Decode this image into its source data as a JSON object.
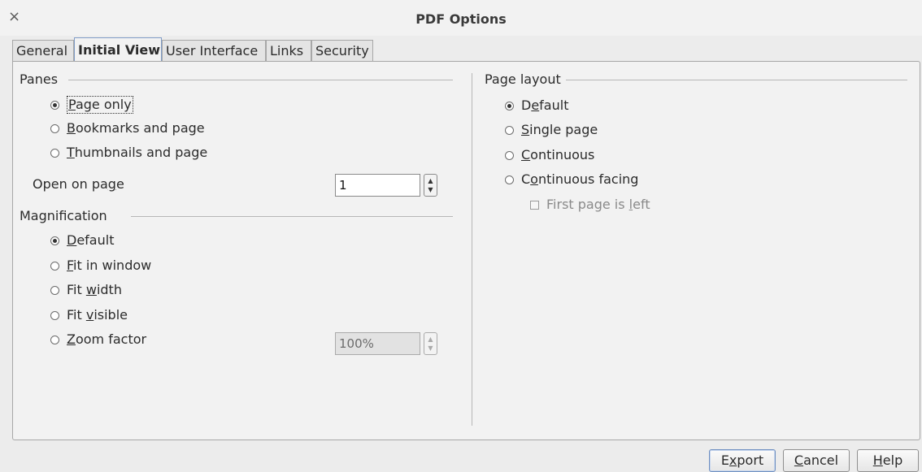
{
  "window": {
    "title": "PDF Options",
    "close_glyph": "×"
  },
  "tabs": [
    {
      "label": "General",
      "active": false
    },
    {
      "label": "Initial View",
      "active": true
    },
    {
      "label": "User Interface",
      "active": false
    },
    {
      "label": "Links",
      "active": false
    },
    {
      "label": "Security",
      "active": false
    }
  ],
  "panes": {
    "heading": "Panes",
    "options": [
      {
        "pre": "",
        "mn": "P",
        "post": "age only",
        "selected": true
      },
      {
        "pre": "",
        "mn": "B",
        "post": "ookmarks and page",
        "selected": false
      },
      {
        "pre": "",
        "mn": "T",
        "post": "humbnails and page",
        "selected": false
      }
    ],
    "open_on_page": {
      "pre": "Open on pa",
      "mn": "g",
      "post": "e",
      "value": "1"
    }
  },
  "magnification": {
    "heading": "Magnification",
    "options": [
      {
        "pre": "",
        "mn": "D",
        "post": "efault",
        "selected": true
      },
      {
        "pre": "",
        "mn": "F",
        "post": "it in window",
        "selected": false
      },
      {
        "pre": "Fit ",
        "mn": "w",
        "post": "idth",
        "selected": false
      },
      {
        "pre": "Fit ",
        "mn": "v",
        "post": "isible",
        "selected": false
      },
      {
        "pre": "",
        "mn": "Z",
        "post": "oom factor",
        "selected": false
      }
    ],
    "zoom_value": "100%"
  },
  "page_layout": {
    "heading": "Page layout",
    "options": [
      {
        "pre": "D",
        "mn": "e",
        "post": "fault",
        "selected": true
      },
      {
        "pre": "",
        "mn": "S",
        "post": "ingle page",
        "selected": false
      },
      {
        "pre": "",
        "mn": "C",
        "post": "ontinuous",
        "selected": false
      },
      {
        "pre": "C",
        "mn": "o",
        "post": "ntinuous facing",
        "selected": false
      }
    ],
    "first_page_left": {
      "pre": "First page is ",
      "mn": "l",
      "post": "eft",
      "checked": false
    }
  },
  "buttons": {
    "export": {
      "pre": "E",
      "mn": "x",
      "post": "port"
    },
    "cancel": {
      "pre": "",
      "mn": "C",
      "post": "ancel"
    },
    "help": {
      "pre": "",
      "mn": "H",
      "post": "elp"
    }
  }
}
